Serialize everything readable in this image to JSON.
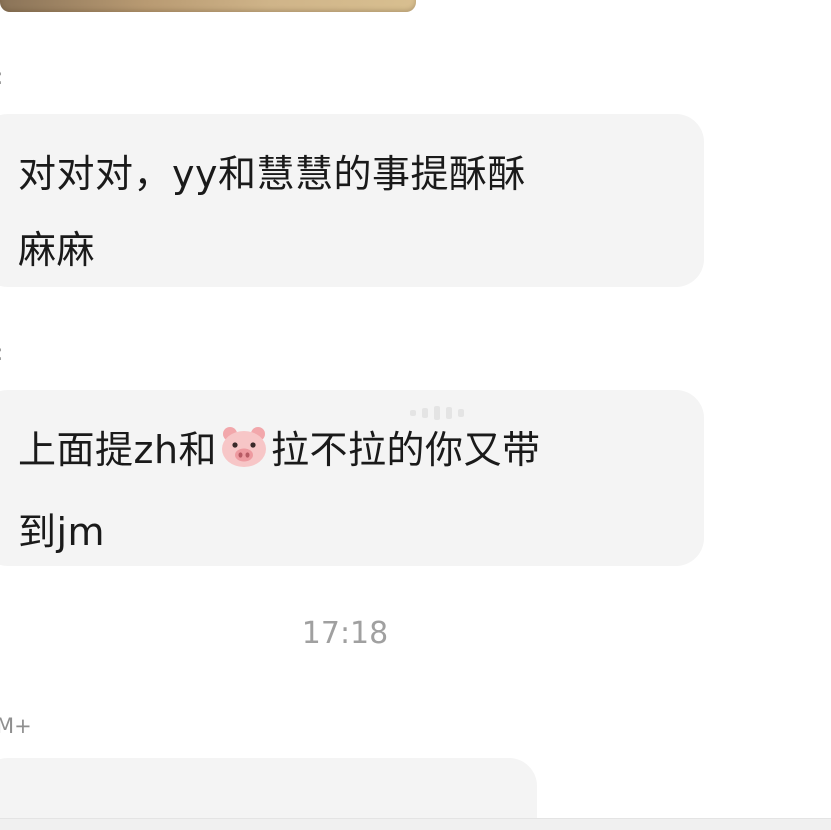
{
  "chat": {
    "messages": [
      {
        "sender_fragment": ":",
        "text": "对对对，yy和慧慧的事提酥酥\n麻麻"
      },
      {
        "sender_fragment": ":",
        "text_before_emoji": "上面提zh和",
        "emoji": "pig-face",
        "text_after_emoji": "拉不拉的你又带\n到jm"
      }
    ],
    "timestamp": "17:18",
    "next_sender_fragment": "M+"
  },
  "colors": {
    "bubble_bg": "#f4f4f4",
    "text": "#1a1a1a",
    "meta_text": "#a0a0a0"
  }
}
